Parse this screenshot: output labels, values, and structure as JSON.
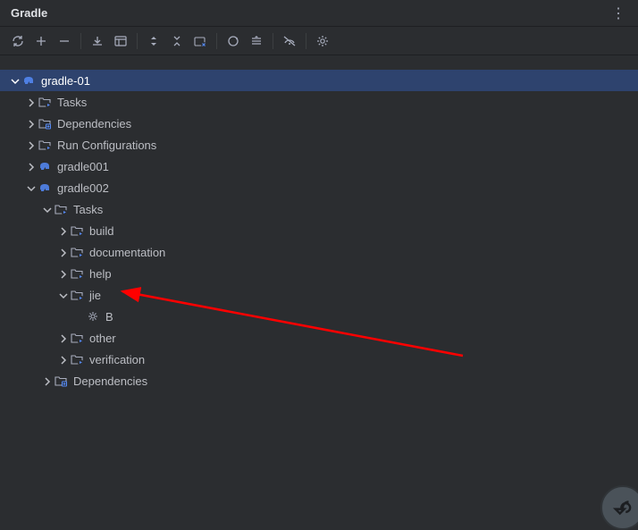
{
  "header": {
    "title": "Gradle"
  },
  "tree": {
    "root": {
      "label": "gradle-01",
      "expanded": true,
      "selected": true,
      "icon": "elephant",
      "children": [
        {
          "label": "Tasks",
          "icon": "folder-run",
          "expanded": false,
          "children": []
        },
        {
          "label": "Dependencies",
          "icon": "folder-deps",
          "expanded": false,
          "children": []
        },
        {
          "label": "Run Configurations",
          "icon": "folder-run",
          "expanded": false,
          "children": []
        },
        {
          "label": "gradle001",
          "icon": "elephant",
          "expanded": false,
          "children": []
        },
        {
          "label": "gradle002",
          "icon": "elephant",
          "expanded": true,
          "children": [
            {
              "label": "Tasks",
              "icon": "folder-run",
              "expanded": true,
              "children": [
                {
                  "label": "build",
                  "icon": "folder-run",
                  "expanded": false,
                  "children": []
                },
                {
                  "label": "documentation",
                  "icon": "folder-run",
                  "expanded": false,
                  "children": []
                },
                {
                  "label": "help",
                  "icon": "folder-run",
                  "expanded": false,
                  "children": []
                },
                {
                  "label": "jie",
                  "icon": "folder-run",
                  "expanded": true,
                  "children": [
                    {
                      "label": "B",
                      "icon": "gear",
                      "leaf": true
                    }
                  ]
                },
                {
                  "label": "other",
                  "icon": "folder-run",
                  "expanded": false,
                  "children": []
                },
                {
                  "label": "verification",
                  "icon": "folder-run",
                  "expanded": false,
                  "children": []
                }
              ]
            },
            {
              "label": "Dependencies",
              "icon": "folder-deps",
              "expanded": false,
              "children": []
            }
          ]
        }
      ]
    }
  }
}
